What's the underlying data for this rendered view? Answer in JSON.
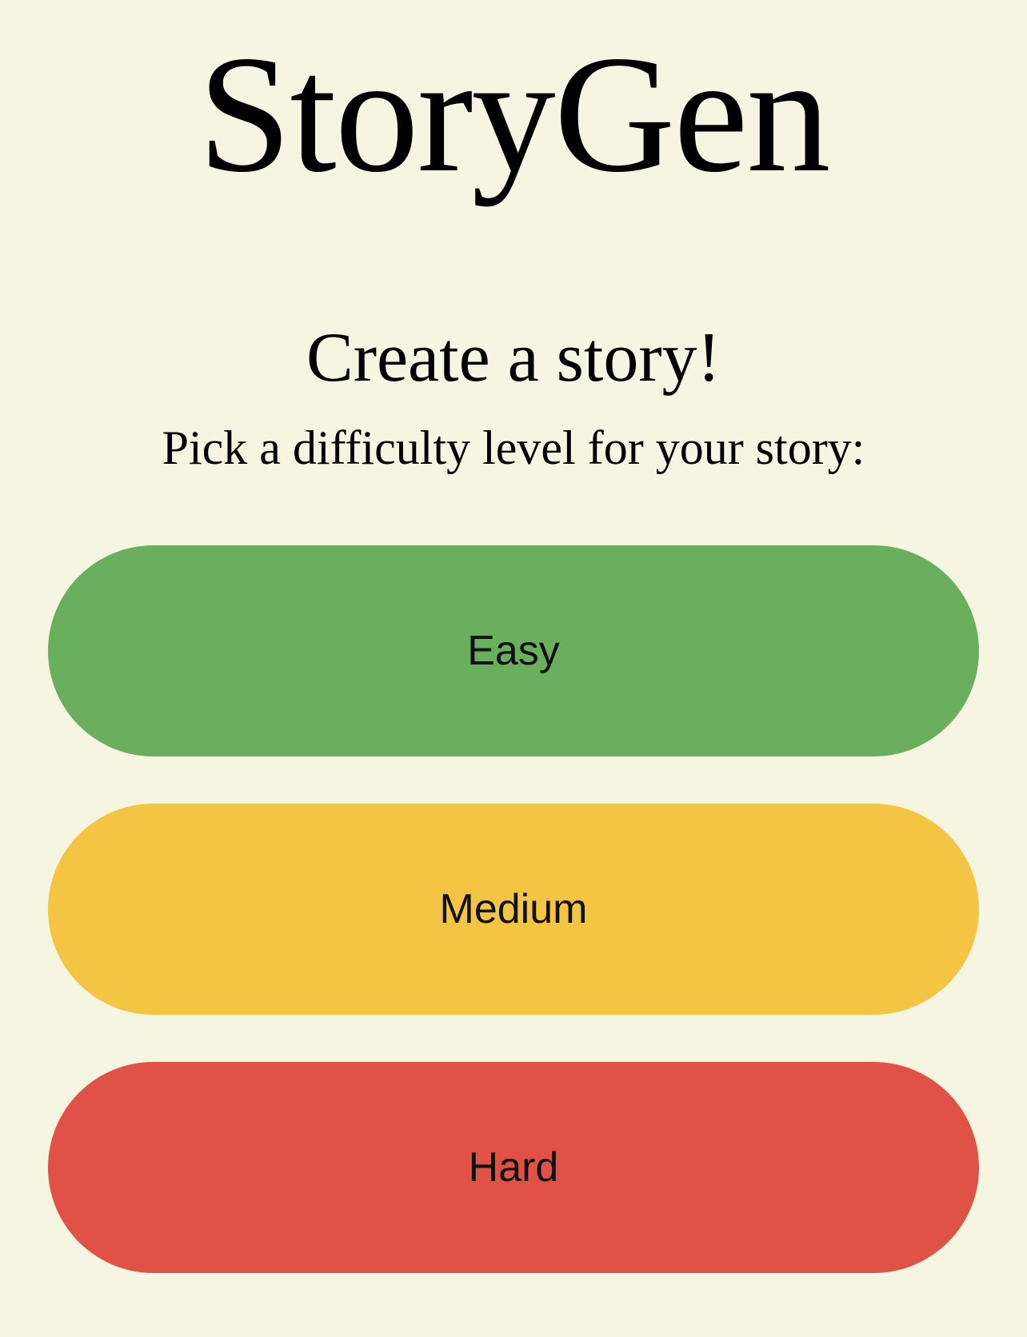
{
  "app": {
    "title": "StoryGen"
  },
  "main": {
    "heading": "Create a story!",
    "prompt": "Pick a difficulty level for your story:"
  },
  "difficulty_buttons": [
    {
      "label": "Easy",
      "color": "#6aaf5e"
    },
    {
      "label": "Medium",
      "color": "#f4c443"
    },
    {
      "label": "Hard",
      "color": "#e05245"
    }
  ],
  "colors": {
    "background": "#f5f5e1",
    "text": "#000000"
  }
}
